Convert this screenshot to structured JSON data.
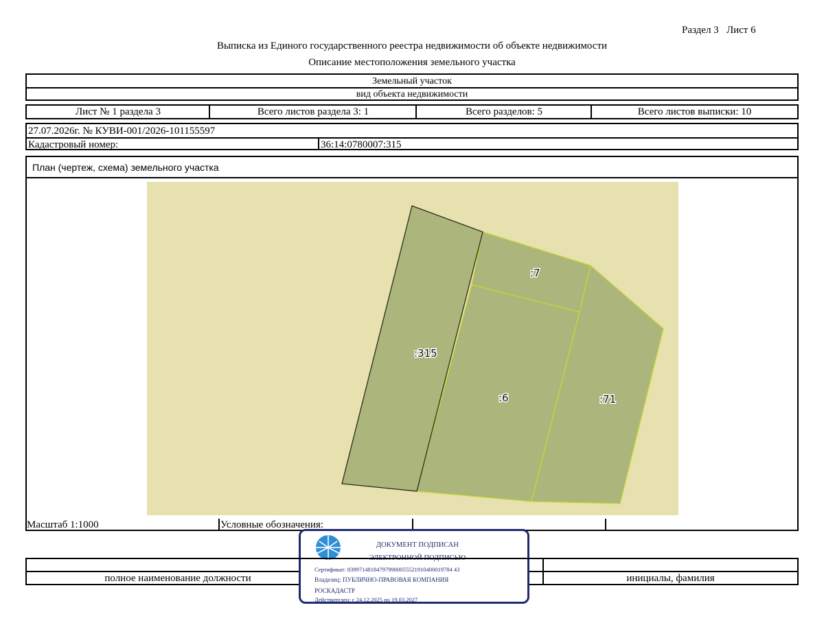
{
  "header": {
    "section": "Раздел 3",
    "sheet": "Лист 6",
    "title": "Выписка из Единого государственного реестра недвижимости об объекте недвижимости",
    "subtitle": "Описание местоположения земельного участка"
  },
  "object": {
    "type": "Земельный участок",
    "type_caption": "вид объекта недвижимости"
  },
  "sheets": {
    "sheet_no": "Лист № 1 раздела 3",
    "total_section_sheets": "Всего листов раздела 3: 1",
    "total_sections": "Всего разделов: 5",
    "total_extract_sheets": "Всего листов выписки: 10"
  },
  "doc": {
    "date_number": "27.07.2026г. № КУВИ-001/2026-101155597",
    "cadastral_label": "Кадастровый номер:",
    "cadastral_value": "36:14:0780007:315"
  },
  "plan": {
    "title": "План (чертеж, схема) земельного участка",
    "parcels": [
      {
        "label": ":315",
        "highlighted": true
      },
      {
        "label": ":7",
        "highlighted": false
      },
      {
        "label": ":6",
        "highlighted": false
      },
      {
        "label": ":71",
        "highlighted": false
      }
    ],
    "colors": {
      "background": "#e6e1ae",
      "parcel_fill": "#abb57c",
      "outline_main": "#2b2b1b",
      "outline_neighbor": "#c8d635"
    }
  },
  "footer": {
    "scale": "Масштаб 1:1000",
    "legend_label": "Условные обозначения:",
    "position_caption": "полное наименование должности",
    "initials_caption": "инициалы, фамилия"
  },
  "signature": {
    "line1": "ДОКУМЕНТ ПОДПИСАН",
    "line2": "ЭЛЕКТРОННОЙ ПОДПИСЬЮ",
    "certificate": "Сертификат: 839971481847979980055521910400019784 43",
    "owner": "Владелец: ПУБЛИЧНО-ПРАВОВАЯ КОМПАНИЯ",
    "owner2": "РОСКАДАСТР",
    "valid": "Действителен: с 24.12.2025 по 19.03.2027",
    "logo_icon": "roskadastr-logo-icon"
  }
}
